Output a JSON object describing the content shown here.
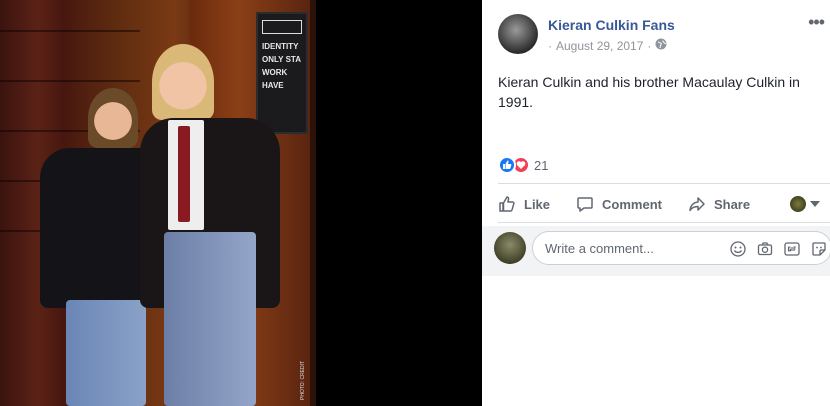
{
  "post": {
    "page_name": "Kieran Culkin Fans",
    "date": "August 29, 2017",
    "separator": "·",
    "text": "Kieran Culkin and his brother Macaulay Culkin in 1991."
  },
  "photo": {
    "sign_lines": [
      "IDENTITY",
      "ONLY STA",
      "WORK",
      "HAVE"
    ],
    "credit": "PHOTO: CREDIT"
  },
  "reactions": {
    "count": "21"
  },
  "actions": {
    "like": "Like",
    "comment": "Comment",
    "share": "Share"
  },
  "comment": {
    "placeholder": "Write a comment..."
  },
  "icons": {
    "more": "more-options-icon",
    "globe": "globe-icon",
    "like": "thumbs-up-icon",
    "comment": "speech-bubble-icon",
    "share": "share-arrow-icon",
    "emoji": "smiley-icon",
    "camera": "camera-icon",
    "gif": "gif-icon",
    "sticker": "sticker-icon"
  },
  "colors": {
    "link": "#385898",
    "like_reaction": "#1877f2",
    "love_reaction": "#f33e58",
    "meta": "#90949c",
    "action_text": "#606770"
  }
}
